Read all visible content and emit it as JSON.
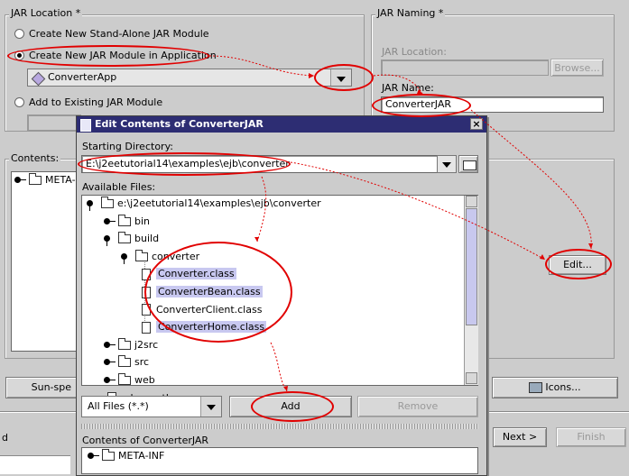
{
  "jar_location": {
    "legend": "JAR Location *",
    "options": [
      "Create New Stand-Alone JAR Module",
      "Create New JAR Module in Application",
      "Add to Existing JAR Module"
    ],
    "app_combo_value": "ConverterApp"
  },
  "jar_naming": {
    "legend": "JAR Naming *",
    "jar_location_label": "JAR Location:",
    "browse_label": "Browse...",
    "jar_name_label": "JAR Name:",
    "jar_name_value": "ConverterJAR"
  },
  "contents": {
    "label": "Contents:",
    "root_item": "META-...",
    "edit_label": "Edit...",
    "sunspec_label": "Sun-spe",
    "icons_label": "Icons..."
  },
  "footer": {
    "left_label": "d",
    "next_label": "Next >",
    "finish_label": "Finish"
  },
  "dialog": {
    "title": "Edit Contents of ConverterJAR",
    "starting_dir_label": "Starting Directory:",
    "starting_dir_value": "E:\\j2eetutorial14\\examples\\ejb\\converter",
    "available_label": "Available Files:",
    "tree": [
      {
        "text": "e:\\j2eetutorial14\\examples\\ejb\\converter",
        "icon": "folder",
        "level": 0,
        "open": true
      },
      {
        "text": "bin",
        "icon": "folder",
        "level": 1,
        "open": false
      },
      {
        "text": "build",
        "icon": "folder",
        "level": 1,
        "open": true
      },
      {
        "text": "converter",
        "icon": "folder",
        "level": 2,
        "open": true
      },
      {
        "text": "Converter.class",
        "icon": "file",
        "level": 3,
        "selected": true
      },
      {
        "text": "ConverterBean.class",
        "icon": "file",
        "level": 3,
        "selected": true
      },
      {
        "text": "ConverterClient.class",
        "icon": "file",
        "level": 3,
        "selected": false
      },
      {
        "text": "ConverterHome.class",
        "icon": "file",
        "level": 3,
        "selected": true
      },
      {
        "text": "j2src",
        "icon": "folder",
        "level": 1,
        "open": false
      },
      {
        "text": "src",
        "icon": "folder",
        "level": 1,
        "open": false
      },
      {
        "text": "web",
        "icon": "folder",
        "level": 1,
        "open": false
      },
      {
        "text": ".classpath",
        "icon": "file",
        "level": 1,
        "selected": false
      }
    ],
    "filter_value": "All Files (*.*)",
    "add_label": "Add",
    "remove_label": "Remove",
    "contents_label": "Contents of ConverterJAR",
    "contents_root": "META-INF"
  },
  "colors": {
    "annotation": "#e10000",
    "title_bar": "#2d2d73",
    "selection": "#c8c8f0"
  }
}
